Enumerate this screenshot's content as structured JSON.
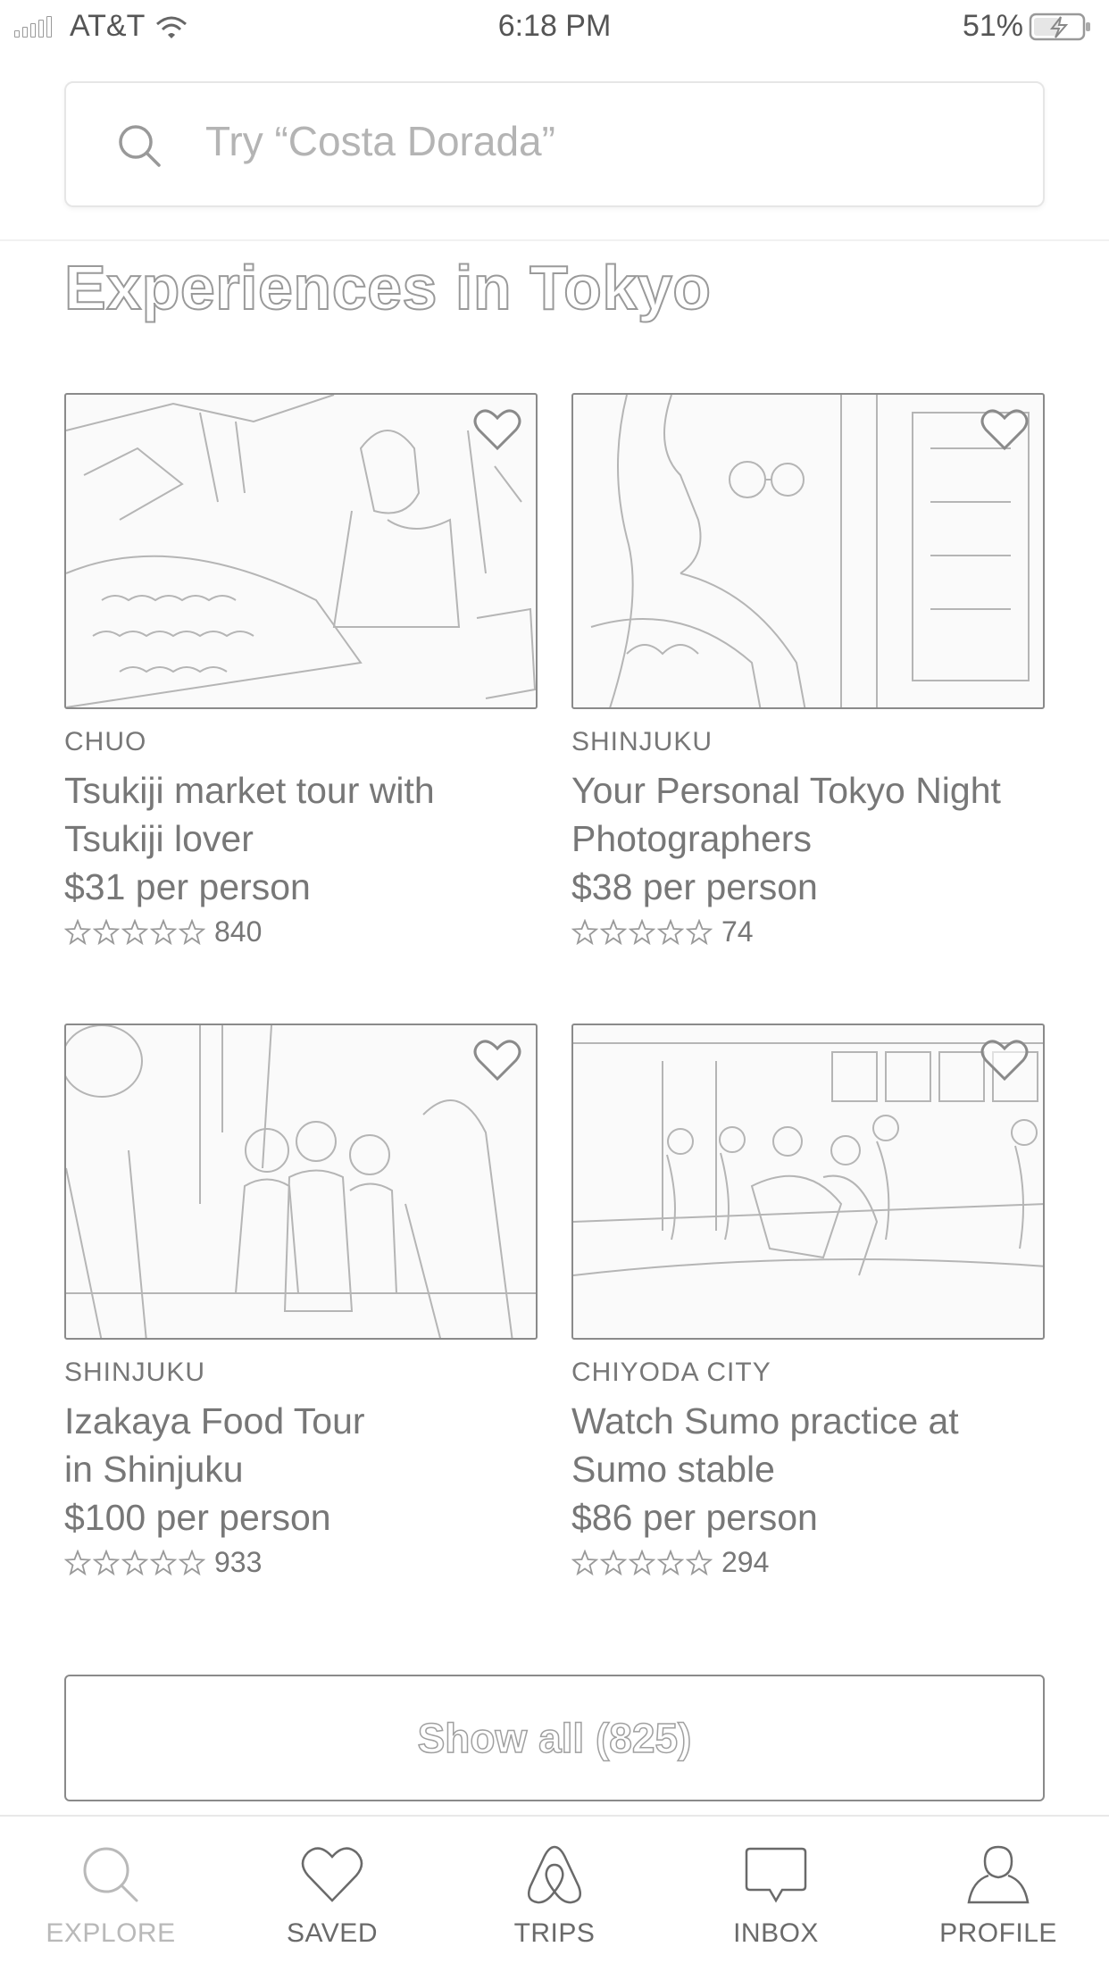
{
  "status_bar": {
    "carrier": "AT&T",
    "time": "6:18 PM",
    "battery": "51%"
  },
  "search": {
    "placeholder": "Try “Costa Dorada”"
  },
  "section": {
    "title": "Experiences in Tokyo"
  },
  "experiences": [
    {
      "location": "CHUO",
      "name_line1": "Tsukiji market tour with",
      "name_line2": "Tsukiji lover",
      "price": "$31 per person",
      "stars": 5,
      "reviews": "840"
    },
    {
      "location": "SHINJUKU",
      "name_line1": "Your Personal Tokyo Night",
      "name_line2": "Photographers",
      "price": "$38 per person",
      "stars": 5,
      "reviews": "74"
    },
    {
      "location": "SHINJUKU",
      "name_line1": "Izakaya Food Tour",
      "name_line2": "in Shinjuku",
      "price": "$100 per person",
      "stars": 5,
      "reviews": "933"
    },
    {
      "location": "CHIYODA CITY",
      "name_line1": "Watch Sumo practice at",
      "name_line2": "Sumo stable",
      "price": "$86 per person",
      "stars": 5,
      "reviews": "294"
    }
  ],
  "show_all": {
    "label": "Show all (825)"
  },
  "tabs": [
    {
      "label": "EXPLORE",
      "icon": "search-icon",
      "active": true
    },
    {
      "label": "SAVED",
      "icon": "heart-icon",
      "active": false
    },
    {
      "label": "TRIPS",
      "icon": "airbnb-logo-icon",
      "active": false
    },
    {
      "label": "INBOX",
      "icon": "chat-bubble-icon",
      "active": false
    },
    {
      "label": "PROFILE",
      "icon": "person-icon",
      "active": false
    }
  ],
  "colors": {
    "outline": "#8a8a8a",
    "active_tab": "#b9b9b9",
    "text": "#777777"
  }
}
